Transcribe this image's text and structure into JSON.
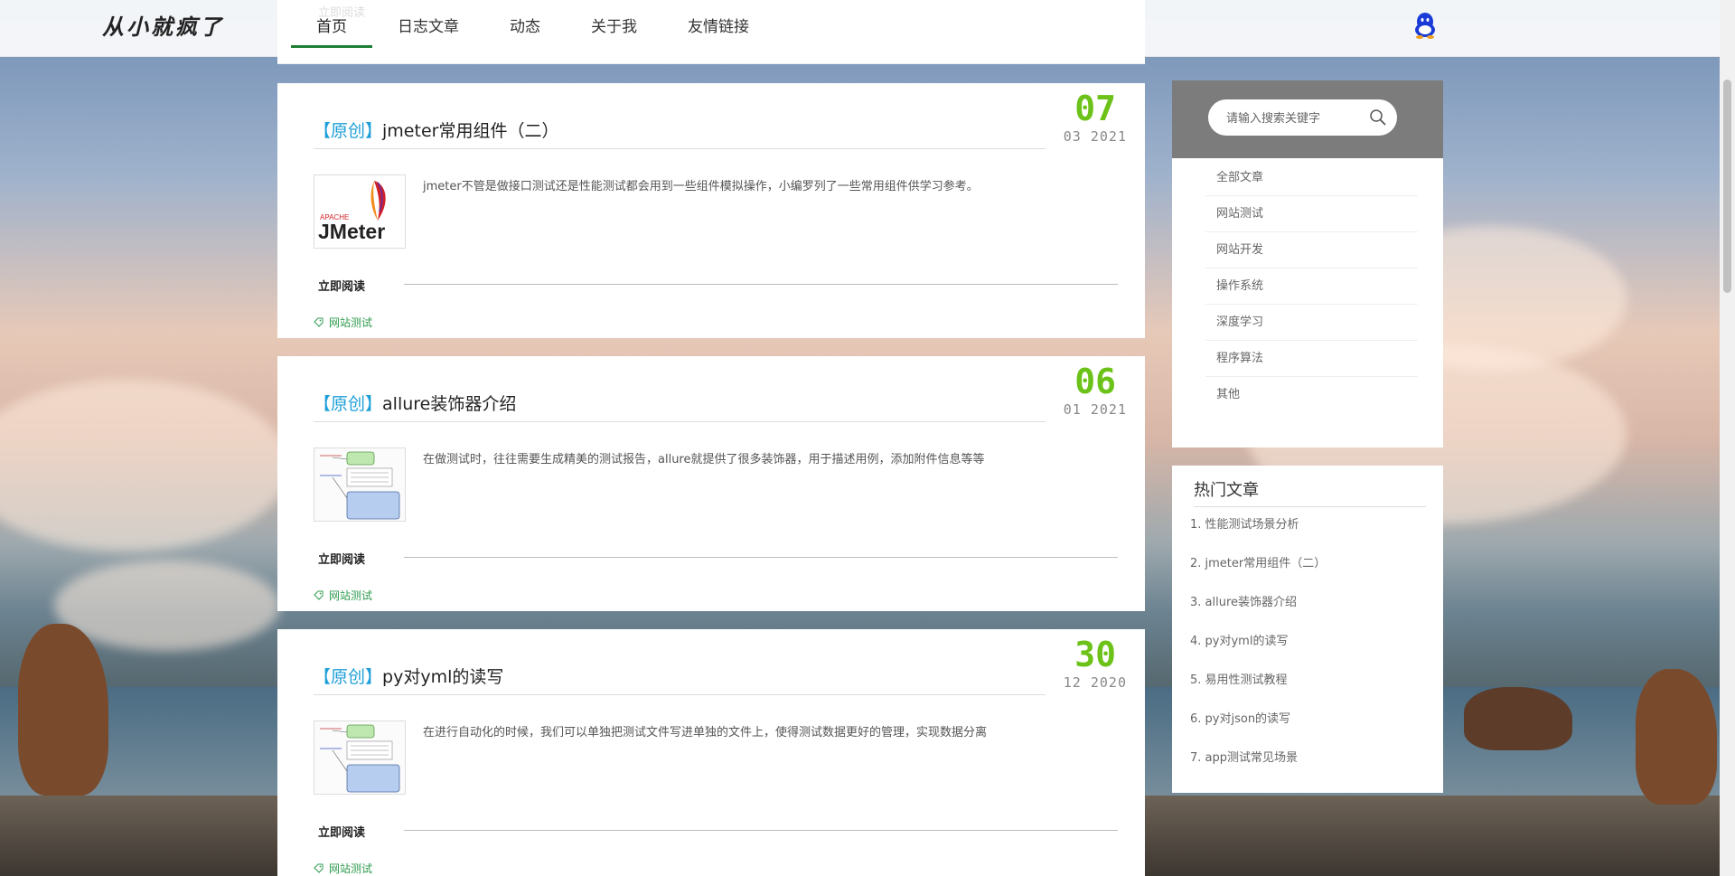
{
  "site": {
    "logo": "从小就疯了"
  },
  "nav": {
    "ghost_text": "立即阅读",
    "items": [
      {
        "label": "首页",
        "active": true
      },
      {
        "label": "日志文章",
        "active": false
      },
      {
        "label": "动态",
        "active": false
      },
      {
        "label": "关于我",
        "active": false
      },
      {
        "label": "友情链接",
        "active": false
      }
    ]
  },
  "posts": [
    {
      "tag": "【原创】",
      "title": "jmeter常用组件（二）",
      "day": "07",
      "month_year": "03 2021",
      "excerpt": "jmeter不管是做接口测试还是性能测试都会用到一些组件模拟操作，小编罗列了一些常用组件供学习参考。",
      "thumb": "jmeter-logo",
      "thumb_text_small": "APACHE",
      "thumb_text_big": "JMeter",
      "read_more": "立即阅读",
      "category": "网站测试"
    },
    {
      "tag": "【原创】",
      "title": "allure装饰器介绍",
      "day": "06",
      "month_year": "01 2021",
      "excerpt": "在做测试时，往往需要生成精美的测试报告，allure就提供了很多装饰器，用于描述用例，添加附件信息等等",
      "thumb": "diagram",
      "read_more": "立即阅读",
      "category": "网站测试"
    },
    {
      "tag": "【原创】",
      "title": "py对yml的读写",
      "day": "30",
      "month_year": "12 2020",
      "excerpt": "在进行自动化的时候，我们可以单独把测试文件写进单独的文件上，使得测试数据更好的管理，实现数据分离",
      "thumb": "diagram",
      "read_more": "立即阅读",
      "category": "网站测试"
    }
  ],
  "sidebar": {
    "search_placeholder": "请输入搜索关键字",
    "categories": [
      "全部文章",
      "网站测试",
      "网站开发",
      "操作系统",
      "深度学习",
      "程序算法",
      "其他"
    ],
    "hot_title": "热门文章",
    "hot_items": [
      "1. 性能测试场景分析",
      "2. jmeter常用组件（二）",
      "3. allure装饰器介绍",
      "4. py对yml的读写",
      "5. 易用性测试教程",
      "6. py对json的读写",
      "7. app测试常见场景"
    ]
  },
  "colors": {
    "date_green": "#6cc218",
    "orig_blue": "#1e9fd8",
    "tag_green": "#2e9b4e",
    "nav_active": "#1e7e34",
    "search_bg": "#7c7c7c"
  }
}
